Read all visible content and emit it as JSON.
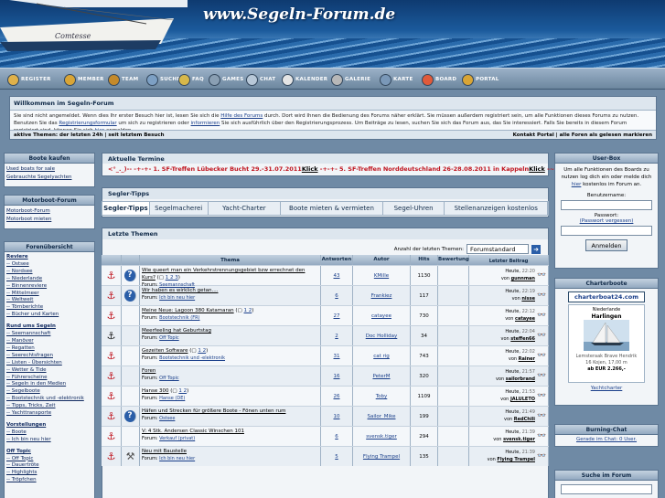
{
  "header": {
    "title": "www.Segeln-Forum.de",
    "boat_name": "Comtesse"
  },
  "nav": [
    {
      "label": "REGISTER",
      "icon": "register-icon",
      "color": "#e0b14a"
    },
    {
      "label": "MEMBER",
      "icon": "member-icon",
      "color": "#d9a536"
    },
    {
      "label": "TEAM",
      "icon": "team-icon",
      "color": "#c48a2b"
    },
    {
      "label": "SUCHE",
      "icon": "search-icon",
      "color": "#7da0c4"
    },
    {
      "label": "FAQ",
      "icon": "faq-icon",
      "color": "#d7b84a"
    },
    {
      "label": "GAMES",
      "icon": "games-icon",
      "color": "#8a9fb3"
    },
    {
      "label": "CHAT",
      "icon": "chat-icon",
      "color": "#b8c8d8"
    },
    {
      "label": "KALENDER",
      "icon": "calendar-icon",
      "color": "#e5e5e5"
    },
    {
      "label": "GALERIE",
      "icon": "gallery-icon",
      "color": "#b8b8b8"
    },
    {
      "label": "KARTE",
      "icon": "map-icon",
      "color": "#7a98b8"
    },
    {
      "label": "BOARD",
      "icon": "board-icon",
      "color": "#e05a3a"
    },
    {
      "label": "PORTAL",
      "icon": "portal-icon",
      "color": "#d9a536"
    }
  ],
  "welcome": {
    "title": "Willkommen im Segeln-Forum",
    "text_1": "Sie sind nicht angemeldet. Wenn dies Ihr erster Besuch hier ist, lesen Sie sich die",
    "link_1": "Hilfe des Forums",
    "text_2": "durch. Dort wird Ihnen die Bedienung des Forums näher erklärt. Sie müssen außerdem registriert sein, um alle Funktionen dieses Forums zu nutzen. Benutzen Sie das",
    "link_2": "Registrierungsformular",
    "text_3": "um sich zu registrieren oder",
    "link_3": "informieren",
    "text_4": "Sie sich ausführlich über den Registrierungsprozess. Um Beiträge zu lesen, suchen Sie sich das Forum aus, das Sie interessiert. Falls Sie bereits in diesem Forum registriert sind, können Sie sich",
    "link_4": "hier",
    "text_5": "anmelden.",
    "active_topics": "aktive Themen: der letzten 24h | seit letztem Besuch",
    "right_links": "Kontakt Portal | alle Foren als gelesen markieren"
  },
  "left": {
    "boote_kaufen": {
      "title": "Boote kaufen",
      "items": [
        "Used boats for sale",
        "Gebrauchte Segelyachten"
      ]
    },
    "motorboot": {
      "title": "Motorboot-Forum",
      "items": [
        "Motorboot-Forum",
        "Motorboot mieten"
      ]
    },
    "forenuebersicht": {
      "title": "Forenübersicht",
      "items": [
        "Reviere",
        "-- Ostsee",
        "-- Nordsee",
        "-- Niederlande",
        "-- Binnenreviere",
        "-- Mittelmeer",
        "-- Weltweit",
        "-- Törnberichte",
        "-- Bücher und Karten",
        "",
        "Rund ums Segeln",
        "-- Seemannschaft",
        "-- Manöver",
        "-- Regatten",
        "-- Seerechtsfragen",
        "-- Listen - Übersichten",
        "-- Wetter & Tide",
        "-- Führerscheine",
        "-- Segeln in den Medien",
        "-- Segelboote",
        "-- Bootstechnik und -elektronik",
        "-- Tipps, Tricks, Zeit",
        "-- Yachttransporte",
        "",
        "Vorstellungen",
        "-- Boote",
        "-- Ich bin neu hier",
        "",
        "Off Topic",
        "-- Off Topic",
        "-- Dauertröte",
        "-- Highlights",
        "-- Tröpfchen"
      ]
    }
  },
  "termine": {
    "title": "Aktuelle Termine",
    "line": "<°_._)-- -+-+- 1. SF-Treffen Lübecker Bucht 29.-31.07.2011",
    "klick1": "Klick",
    "line2": " -+-+- 5. SF-Treffen Norddeutschland 26-28.08.2011 in Kappeln",
    "klick2": "Klick",
    "tail": " -~ ~_ ~-"
  },
  "tipps": {
    "title": "Segler-Tipps",
    "tabs": [
      "Segler-Tipps",
      "Segelmacherei",
      "Yacht-Charter",
      "Boote mieten & vermieten",
      "Segel-Uhren",
      "Stellenanzeigen kostenlos"
    ]
  },
  "letzte": {
    "title": "Letzte Themen",
    "count_label": "Anzahl der letzten Themen:",
    "count_value": "Forumstandard",
    "headers": [
      "Thema",
      "Antworten",
      "Autor",
      "Hits",
      "Bewertung",
      "Letzter Beitrag"
    ],
    "rows": [
      {
        "icon": "anchor",
        "type": "question",
        "title": "Wie queert man ein Verkehrstrennungsgebiet bzw errechnet den Kurs?",
        "pages": "1 2 3",
        "forum": "Seemannschaft",
        "answers": "43",
        "author": "KMille",
        "hits": "1130",
        "date": "Heute,",
        "time": "22:20",
        "by": "gunnman"
      },
      {
        "icon": "anchor",
        "type": "question",
        "title": "Wir haben es wirklich getan....",
        "pages": "",
        "forum": "Ich bin neu hier",
        "answers": "6",
        "author": "Frankiez",
        "hits": "117",
        "date": "Heute,",
        "time": "22:19",
        "by": "nisse"
      },
      {
        "icon": "anchor",
        "type": "none",
        "title": "Meine Neue: Lagoon 380 Katamaran",
        "pages": "1 2",
        "forum": "Bootstechnik (FR)",
        "answers": "27",
        "author": "catayee",
        "hits": "730",
        "date": "Heute,",
        "time": "22:12",
        "by": "catayee"
      },
      {
        "icon": "anchor-black",
        "type": "none",
        "title": "Meerfeeling hat Geburtstag",
        "pages": "",
        "forum": "Off Topic",
        "answers": "2",
        "author": "Doc Holliday",
        "hits": "34",
        "date": "Heute,",
        "time": "22:04",
        "by": "steffen66"
      },
      {
        "icon": "anchor",
        "type": "none",
        "title": "Gezeiten Software",
        "pages": "1 2",
        "forum": "Bootstechnik und -elektronik",
        "answers": "31",
        "author": "cat rig",
        "hits": "743",
        "date": "Heute,",
        "time": "22:02",
        "by": "Rainer"
      },
      {
        "icon": "anchor",
        "type": "none",
        "title": "Foren",
        "pages": "",
        "forum": "Off Topic",
        "answers": "16",
        "author": "PeterM",
        "hits": "320",
        "date": "Heute,",
        "time": "21:57",
        "by": "sailorbrand"
      },
      {
        "icon": "anchor",
        "type": "none",
        "title": "Hanse 300",
        "pages": "1 2",
        "forum": "Hanse (DE)",
        "answers": "26",
        "author": "Toby",
        "hits": "1109",
        "date": "Heute,",
        "time": "21:53",
        "by": "JALULETO"
      },
      {
        "icon": "anchor",
        "type": "question",
        "title": "Häfen und Strecken für größere Boote - Fönen unten rum",
        "pages": "",
        "forum": "Ostsee",
        "answers": "10",
        "author": "Sailor_Mike",
        "hits": "199",
        "date": "Heute,",
        "time": "21:49",
        "by": "RedChili"
      },
      {
        "icon": "anchor",
        "type": "none",
        "title": "V: 4 Stk. Andersen Classic Winschen 101",
        "pages": "",
        "forum": "Verkauf (privat)",
        "answers": "6",
        "author": "svensk.tiger",
        "hits": "294",
        "date": "Heute,",
        "time": "21:39",
        "by": "svensk.tiger"
      },
      {
        "icon": "anchor",
        "type": "tools",
        "title": "Neu mit Baustelle",
        "pages": "",
        "forum": "Ich bin neu hier",
        "answers": "5",
        "author": "Flying Trampel",
        "hits": "135",
        "date": "Heute,",
        "time": "21:39",
        "by": "Flying Trampel"
      }
    ]
  },
  "userbox": {
    "title": "User-Box",
    "text": "Um alle Funktionen des Boards zu nutzen log dich ein oder melde dich",
    "link": "hier",
    "text2": "kostenlos im Forum an.",
    "user_label": "Benutzername:",
    "pass_label": "Passwort:",
    "forgot": "(Passwort vergessen)",
    "login": "Anmelden"
  },
  "charter": {
    "title": "Charterboote",
    "logo": "charterboat24.com",
    "place": "Niederlande",
    "city": "Harlingen",
    "boat": "Lemsteraak Brave Hendrik",
    "detail": "16 Kojen, 17,00 m",
    "price": "ab EUR 2.266,-",
    "link": "Yachtcharter"
  },
  "chat": {
    "title": "Burning-Chat",
    "text": "Gerade im Chat: 0 User."
  },
  "suche": {
    "title": "Suche im Forum"
  },
  "colors": {
    "accent": "#c0141e",
    "link": "#1a3f8a",
    "panel": "#f2f5f8"
  }
}
